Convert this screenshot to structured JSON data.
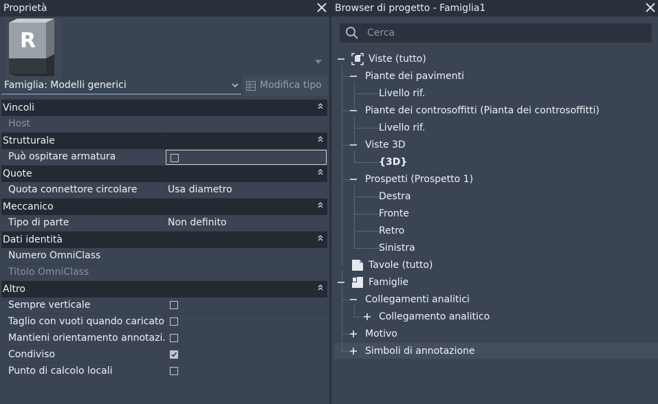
{
  "properties": {
    "title": "Proprietà",
    "family_selector": "Famiglia: Modelli generici",
    "edit_type_label": "Modifica tipo",
    "groups": [
      {
        "name": "Vincoli",
        "rows": [
          {
            "name": "Host",
            "value": "",
            "kind": "text",
            "disabled": true
          }
        ]
      },
      {
        "name": "Strutturale",
        "rows": [
          {
            "name": "Può ospitare armatura",
            "kind": "checkbox",
            "checked": false,
            "active": true
          }
        ]
      },
      {
        "name": "Quote",
        "rows": [
          {
            "name": "Quota connettore circolare",
            "value": "Usa diametro",
            "kind": "text"
          }
        ]
      },
      {
        "name": "Meccanico",
        "rows": [
          {
            "name": "Tipo di parte",
            "value": "Non definito",
            "kind": "text"
          }
        ]
      },
      {
        "name": "Dati identità",
        "rows": [
          {
            "name": "Numero OmniClass",
            "value": "",
            "kind": "text"
          },
          {
            "name": "Titolo OmniClass",
            "value": "",
            "kind": "text",
            "disabled": true
          }
        ]
      },
      {
        "name": "Altro",
        "rows": [
          {
            "name": "Sempre verticale",
            "kind": "checkbox",
            "checked": false
          },
          {
            "name": "Taglio con vuoti quando caricato",
            "kind": "checkbox",
            "checked": false
          },
          {
            "name": "Mantieni orientamento annotazi...",
            "kind": "checkbox",
            "checked": false
          },
          {
            "name": "Condiviso",
            "kind": "checkbox",
            "checked": true
          },
          {
            "name": "Punto di calcolo locali",
            "kind": "checkbox",
            "checked": false
          }
        ]
      }
    ]
  },
  "browser": {
    "title": "Browser di progetto - Famiglia1",
    "search_placeholder": "Cerca",
    "nodes": [
      {
        "label": "Viste (tutto)",
        "level": 0,
        "toggle": "minus",
        "icon": "views-icon"
      },
      {
        "label": "Piante dei pavimenti",
        "level": 1,
        "toggle": "minus"
      },
      {
        "label": "Livello rif.",
        "level": 2
      },
      {
        "label": "Piante dei controsoffitti (Pianta dei controsoffitti)",
        "level": 1,
        "toggle": "minus"
      },
      {
        "label": "Livello rif.",
        "level": 2
      },
      {
        "label": "Viste 3D",
        "level": 1,
        "toggle": "minus"
      },
      {
        "label": "{3D}",
        "level": 2,
        "bold": true
      },
      {
        "label": "Prospetti (Prospetto 1)",
        "level": 1,
        "toggle": "minus"
      },
      {
        "label": "Destra",
        "level": 2
      },
      {
        "label": "Fronte",
        "level": 2
      },
      {
        "label": "Retro",
        "level": 2
      },
      {
        "label": "Sinistra",
        "level": 2
      },
      {
        "label": "Tavole (tutto)",
        "level": 0,
        "icon": "sheets-icon"
      },
      {
        "label": "Famiglie",
        "level": 0,
        "toggle": "minus",
        "icon": "families-icon"
      },
      {
        "label": "Collegamenti analitici",
        "level": 1,
        "toggle": "minus"
      },
      {
        "label": "Collegamento analitico",
        "level": 2,
        "toggle": "plus"
      },
      {
        "label": "Motivo",
        "level": 1,
        "toggle": "plus"
      },
      {
        "label": "Simboli di annotazione",
        "level": 1,
        "toggle": "plus",
        "selected": true
      }
    ]
  },
  "colors": {
    "panel_bg": "#3b4453",
    "header_bg": "#242a34",
    "titlebar_bg": "#2b313c",
    "text": "#eef1f5",
    "muted_text": "#8891a0"
  }
}
